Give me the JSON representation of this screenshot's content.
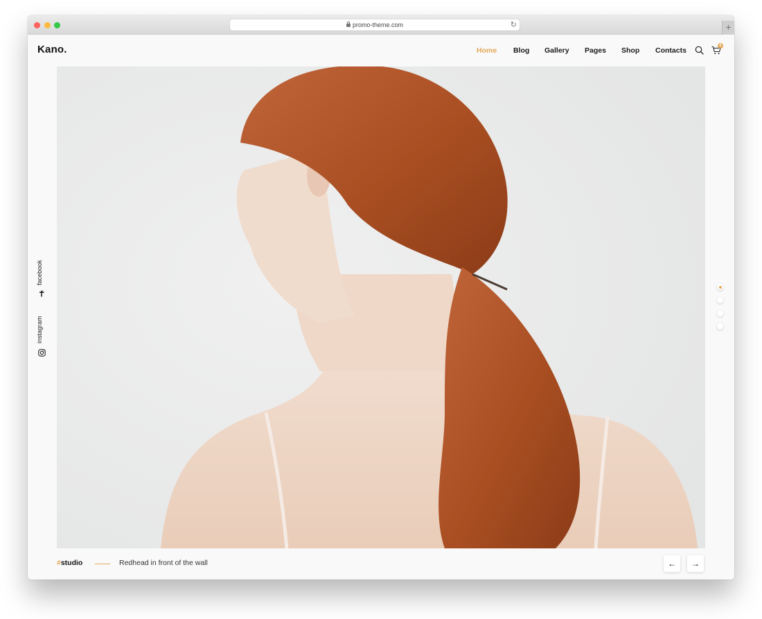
{
  "browser": {
    "url": "promo-theme.com",
    "reload_glyph": "↻",
    "newtab_glyph": "+"
  },
  "site": {
    "logo": "Kano.",
    "nav": [
      {
        "label": "Home",
        "active": true
      },
      {
        "label": "Blog",
        "active": false
      },
      {
        "label": "Gallery",
        "active": false
      },
      {
        "label": "Pages",
        "active": false
      },
      {
        "label": "Shop",
        "active": false
      },
      {
        "label": "Contacts",
        "active": false
      }
    ],
    "cart_count": "0",
    "icons": {
      "search": "search-icon",
      "cart": "cart-icon"
    }
  },
  "social": [
    {
      "label": "facebook",
      "icon": "facebook-icon"
    },
    {
      "label": "instagram",
      "icon": "instagram-icon"
    }
  ],
  "slider": {
    "dots": 4,
    "active_dot": 0,
    "tag_hash": "#",
    "tag": "studio",
    "caption": "Redhead in front of the wall",
    "prev_glyph": "←",
    "next_glyph": "→"
  },
  "colors": {
    "accent": "#e3a857",
    "text": "#111111",
    "background": "#f9f9f9",
    "hero_bg": "#ebebeb",
    "hair": "#b5562a",
    "skin": "#f1dccd"
  }
}
